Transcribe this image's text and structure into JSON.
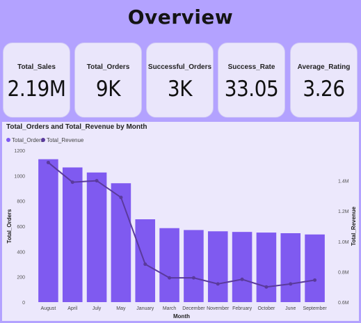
{
  "header": {
    "title": "Overview"
  },
  "kpis": [
    {
      "label": "Total_Sales",
      "value": "2.19M"
    },
    {
      "label": "Total_Orders",
      "value": "9K"
    },
    {
      "label": "Successful_Orders",
      "value": "3K"
    },
    {
      "label": "Success_Rate",
      "value": "33.05"
    },
    {
      "label": "Average_Rating",
      "value": "3.26"
    }
  ],
  "colors": {
    "background": "#b3a2ff",
    "card": "#eae6fb",
    "bar": "#7f5af0",
    "line": "#5a3a9c"
  },
  "chart_data": {
    "type": "bar",
    "title": "Total_Orders and Total_Revenue by Month",
    "xlabel": "Month",
    "ylabel": "Total_Orders",
    "y2label": "Total_Revenue",
    "categories": [
      "August",
      "April",
      "July",
      "May",
      "January",
      "March",
      "December",
      "November",
      "February",
      "October",
      "June",
      "September"
    ],
    "series": [
      {
        "name": "Total_Orders",
        "type": "bar",
        "axis": "left",
        "values": [
          1130,
          1065,
          1025,
          940,
          655,
          585,
          570,
          560,
          555,
          550,
          545,
          535
        ]
      },
      {
        "name": "Total_Revenue",
        "type": "line",
        "axis": "right",
        "values": [
          1.52,
          1.39,
          1.4,
          1.29,
          0.85,
          0.76,
          0.76,
          0.72,
          0.75,
          0.7,
          0.72,
          0.745
        ]
      }
    ],
    "ylim": [
      0,
      1200
    ],
    "yticks": [
      "0",
      "200",
      "400",
      "600",
      "800",
      "1000",
      "1200"
    ],
    "y2lim": [
      0.6,
      1.6
    ],
    "y2ticks": [
      "0.6M",
      "0.8M",
      "1.0M",
      "1.2M",
      "1.4M"
    ],
    "legend": "top-left"
  }
}
